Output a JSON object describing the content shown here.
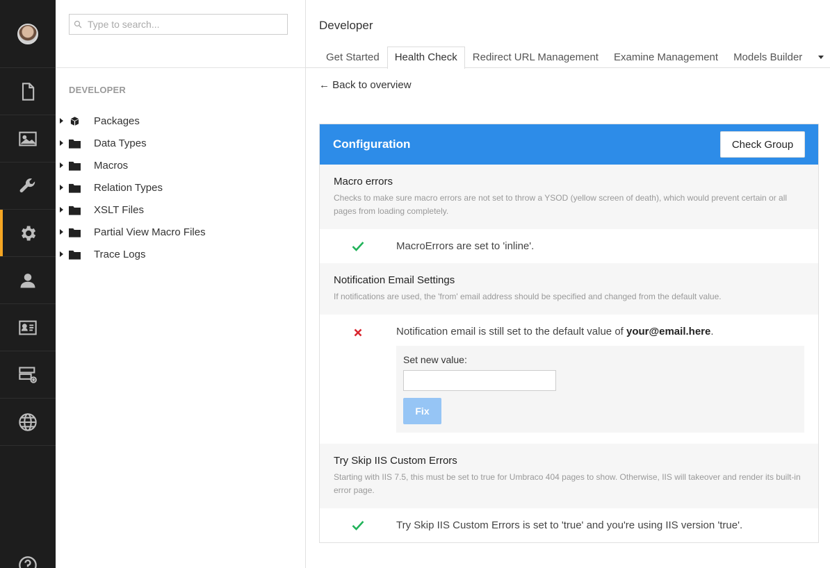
{
  "colors": {
    "accent_blue": "#2d8ce8",
    "rail_bg": "#1d1d1d",
    "active_marker": "#f5a623",
    "success": "#21b35a",
    "error": "#d9262f"
  },
  "rail": {
    "items": [
      {
        "name": "content",
        "icon": "document-icon"
      },
      {
        "name": "media",
        "icon": "image-icon"
      },
      {
        "name": "settings",
        "icon": "wrench-icon"
      },
      {
        "name": "developer",
        "icon": "gear-icon",
        "active": true
      },
      {
        "name": "users",
        "icon": "user-icon"
      },
      {
        "name": "members",
        "icon": "id-card-icon"
      },
      {
        "name": "forms",
        "icon": "server-add-icon"
      },
      {
        "name": "translation",
        "icon": "globe-icon"
      }
    ],
    "help_icon": "help-icon"
  },
  "tree": {
    "search_placeholder": "Type to search...",
    "section_title": "DEVELOPER",
    "nodes": [
      {
        "label": "Packages",
        "icon": "package-icon"
      },
      {
        "label": "Data Types",
        "icon": "folder-icon"
      },
      {
        "label": "Macros",
        "icon": "folder-icon"
      },
      {
        "label": "Relation Types",
        "icon": "folder-icon"
      },
      {
        "label": "XSLT Files",
        "icon": "folder-icon"
      },
      {
        "label": "Partial View Macro Files",
        "icon": "folder-icon"
      },
      {
        "label": "Trace Logs",
        "icon": "folder-icon"
      }
    ]
  },
  "header": {
    "title": "Developer",
    "tabs": [
      {
        "label": "Get Started",
        "active": false
      },
      {
        "label": "Health Check",
        "active": true
      },
      {
        "label": "Redirect URL Management",
        "active": false
      },
      {
        "label": "Examine Management",
        "active": false
      },
      {
        "label": "Models Builder",
        "active": false
      }
    ]
  },
  "main": {
    "back_link": "← Back to overview",
    "group": {
      "title": "Configuration",
      "check_button": "Check Group",
      "checks": [
        {
          "title": "Macro errors",
          "description": "Checks to make sure macro errors are not set to throw a YSOD (yellow screen of death), which would prevent certain or all pages from loading completely.",
          "status": "success",
          "result": "MacroErrors are set to 'inline'."
        },
        {
          "title": "Notification Email Settings",
          "description": "If notifications are used, the 'from' email address should be specified and changed from the default value.",
          "status": "error",
          "result_prefix": "Notification email is still set to the default value of ",
          "result_value": "your@email.here",
          "result_suffix": ".",
          "fix": {
            "label": "Set new value:",
            "input_value": "",
            "button": "Fix"
          }
        },
        {
          "title": "Try Skip IIS Custom Errors",
          "description": "Starting with IIS 7.5, this must be set to true for Umbraco 404 pages to show. Otherwise, IIS will takeover and render its built-in error page.",
          "status": "success",
          "result": "Try Skip IIS Custom Errors is set to 'true' and you're using IIS version 'true'."
        }
      ]
    }
  }
}
